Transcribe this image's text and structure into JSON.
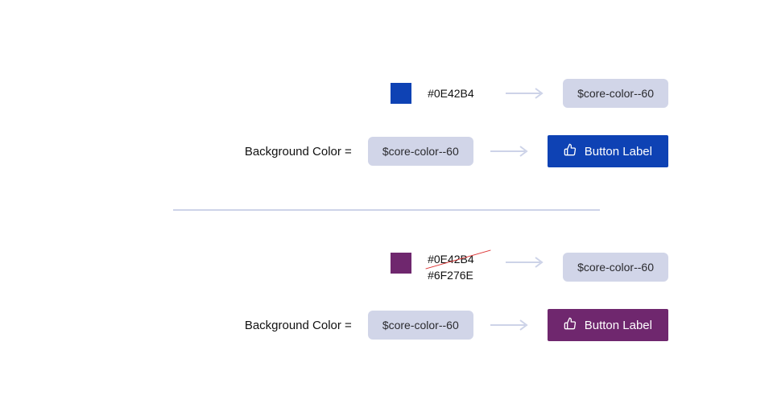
{
  "sections": {
    "top": {
      "row1": {
        "swatch_color": "#0E42B4",
        "hex_primary": "#0E42B4",
        "token": "$core-color--60"
      },
      "row2": {
        "label": "Background Color =",
        "token": "$core-color--60",
        "button_bg": "#0E42B4",
        "button_label": "Button Label"
      }
    },
    "bottom": {
      "row1": {
        "swatch_color": "#6F276E",
        "hex_strike": "#0E42B4",
        "hex_secondary": "#6F276E",
        "token": "$core-color--60"
      },
      "row2": {
        "label": "Background Color =",
        "token": "$core-color--60",
        "button_bg": "#6F276E",
        "button_label": "Button Label"
      }
    }
  }
}
